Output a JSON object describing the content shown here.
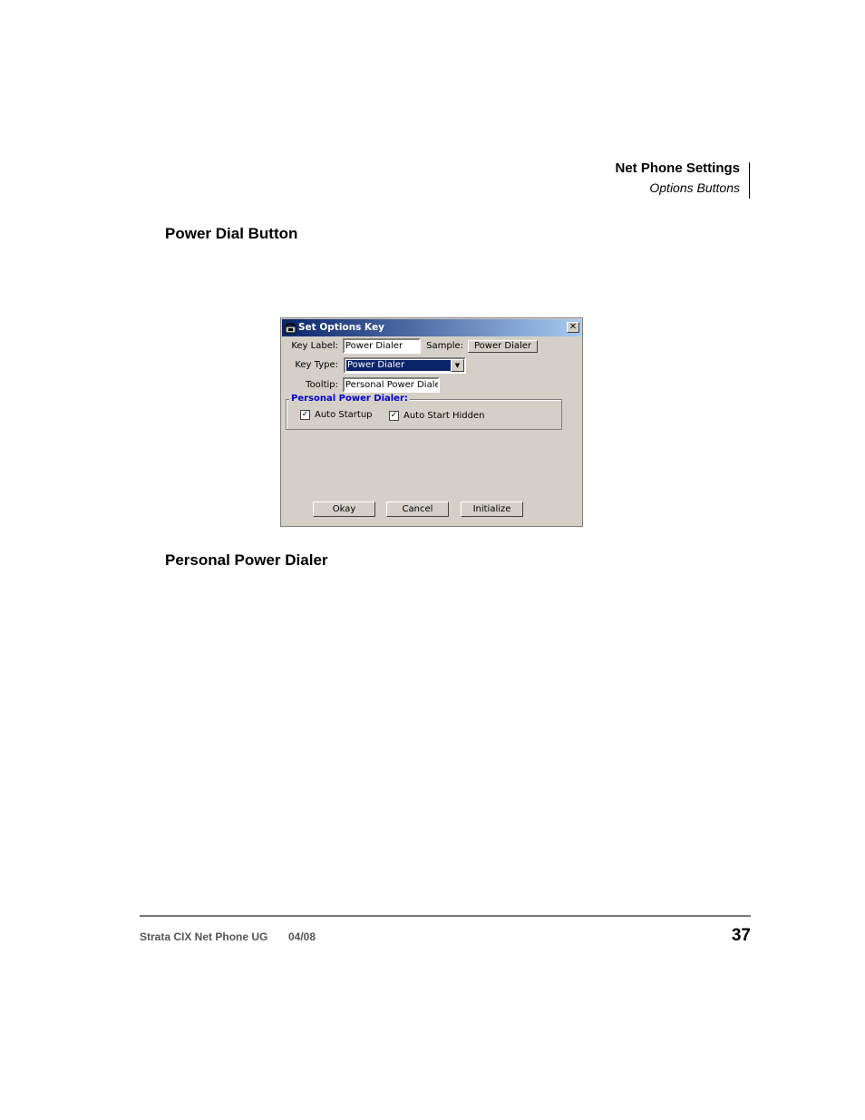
{
  "header": {
    "title": "Net Phone Settings",
    "subtitle": "Options Buttons"
  },
  "sections": {
    "power_dial_button": "Power Dial Button",
    "personal_power_dialer": "Personal Power Dialer"
  },
  "dialog": {
    "title": "Set Options Key",
    "key_label_label": "Key Label:",
    "key_label_value": "Power Dialer",
    "sample_label": "Sample:",
    "sample_button": "Power Dialer",
    "key_type_label": "Key Type:",
    "key_type_value": "Power Dialer",
    "tooltip_label": "Tooltip:",
    "tooltip_value": "Personal Power Dialer",
    "group_title": "Personal Power Dialer:",
    "auto_startup_label": "Auto Startup",
    "auto_startup_checked": true,
    "auto_start_hidden_label": "Auto Start Hidden",
    "auto_start_hidden_checked": true,
    "okay_button": "Okay",
    "cancel_button": "Cancel",
    "initialize_button": "Initialize",
    "close_glyph": "✕"
  },
  "footer": {
    "doc_name": "Strata CIX Net Phone UG",
    "date": "04/08",
    "page_number": "37"
  }
}
